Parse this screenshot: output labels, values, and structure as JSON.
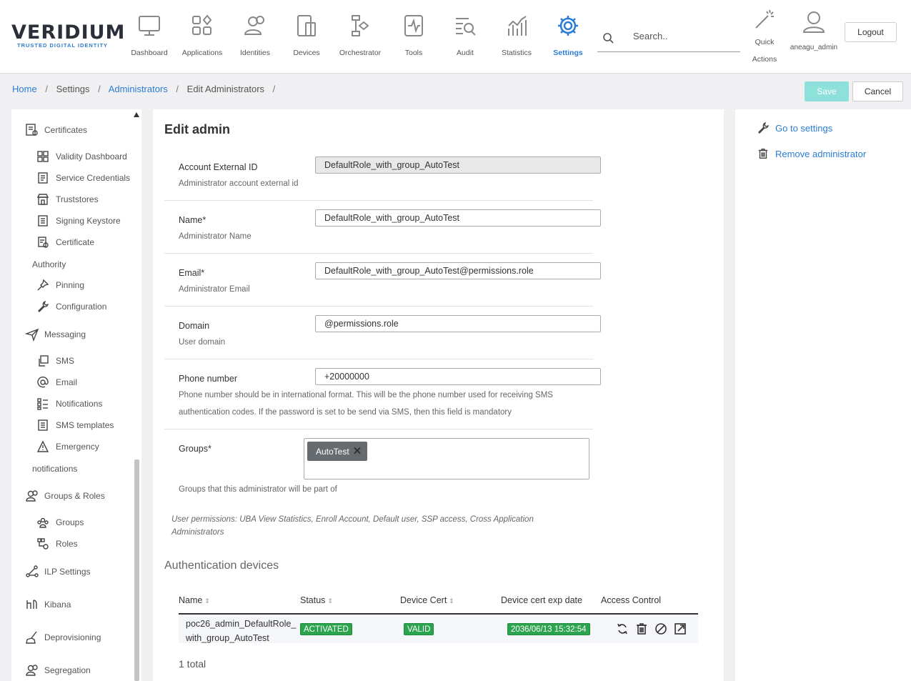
{
  "logo": {
    "name": "VERIDIUM",
    "tagline": "TRUSTED DIGITAL IDENTITY"
  },
  "nav": [
    {
      "label": "Dashboard",
      "icon": "monitor-icon"
    },
    {
      "label": "Applications",
      "icon": "apps-grid-icon"
    },
    {
      "label": "Identities",
      "icon": "users-icon"
    },
    {
      "label": "Devices",
      "icon": "devices-icon"
    },
    {
      "label": "Orchestrator",
      "icon": "orchestrator-icon"
    },
    {
      "label": "Tools",
      "icon": "tools-icon"
    },
    {
      "label": "Audit",
      "icon": "audit-icon"
    },
    {
      "label": "Statistics",
      "icon": "statistics-icon"
    },
    {
      "label": "Settings",
      "icon": "gear-icon",
      "active": true
    }
  ],
  "search": {
    "placeholder": "Search.."
  },
  "quick_actions": {
    "line1": "Quick",
    "line2": "Actions"
  },
  "user": {
    "name": "aneagu_admin"
  },
  "logout_label": "Logout",
  "breadcrumb": {
    "home": "Home",
    "settings": "Settings",
    "administrators": "Administrators",
    "current": "Edit Administrators",
    "sep": "/"
  },
  "actions": {
    "save": "Save",
    "cancel": "Cancel"
  },
  "sidebar": {
    "certificates": "Certificates",
    "validity_dashboard": "Validity Dashboard",
    "service_credentials": "Service Credentials",
    "truststores": "Truststores",
    "signing_keystore": "Signing Keystore",
    "certificate": "Certificate",
    "authority": "Authority",
    "pinning": "Pinning",
    "configuration": "Configuration",
    "messaging": "Messaging",
    "sms": "SMS",
    "email": "Email",
    "notifications": "Notifications",
    "sms_templates": "SMS templates",
    "emergency": "Emergency",
    "emergency_notifications": "notifications",
    "groups_roles": "Groups & Roles",
    "groups": "Groups",
    "roles": "Roles",
    "ilp_settings": "ILP Settings",
    "kibana": "Kibana",
    "deprovisioning": "Deprovisioning",
    "segregation": "Segregation"
  },
  "form": {
    "title": "Edit admin",
    "external_id": {
      "label": "Account External ID",
      "hint": "Administrator account external id",
      "value": "DefaultRole_with_group_AutoTest"
    },
    "name": {
      "label": "Name*",
      "hint": "Administrator Name",
      "value": "DefaultRole_with_group_AutoTest"
    },
    "email": {
      "label": "Email*",
      "hint": "Administrator Email",
      "value": "DefaultRole_with_group_AutoTest@permissions.role"
    },
    "domain": {
      "label": "Domain",
      "hint": "User domain",
      "value": "@permissions.role"
    },
    "phone": {
      "label": "Phone number",
      "hint1": "Phone number should be in international format. This will be the phone number used for receiving SMS",
      "hint2": "authentication codes. If the password is set to be send via SMS, then this field is mandatory",
      "value": "+20000000"
    },
    "groups": {
      "label": "Groups*",
      "hint": "Groups that this administrator will be part of",
      "tags": [
        "AutoTest"
      ]
    },
    "permissions": "User permissions: UBA View Statistics, Enroll Account, Default user, SSP access, Cross Application Administrators"
  },
  "devices": {
    "title": "Authentication devices",
    "columns": {
      "name": "Name",
      "status": "Status",
      "device_cert": "Device Cert",
      "exp_date": "Device cert exp date",
      "access": "Access Control"
    },
    "rows": [
      {
        "name_line1": "poc26_admin_DefaultRole_",
        "name_line2": "with_group_AutoTest",
        "status": "ACTIVATED",
        "cert": "VALID",
        "exp": "2036/06/13 15:32:54"
      }
    ],
    "total": "1 total"
  },
  "right_panel": {
    "go_settings": "Go to settings",
    "remove_admin": "Remove administrator"
  },
  "colors": {
    "accent": "#2b7cd3",
    "success": "#2ca44e",
    "save_disabled": "#8ee0da"
  }
}
